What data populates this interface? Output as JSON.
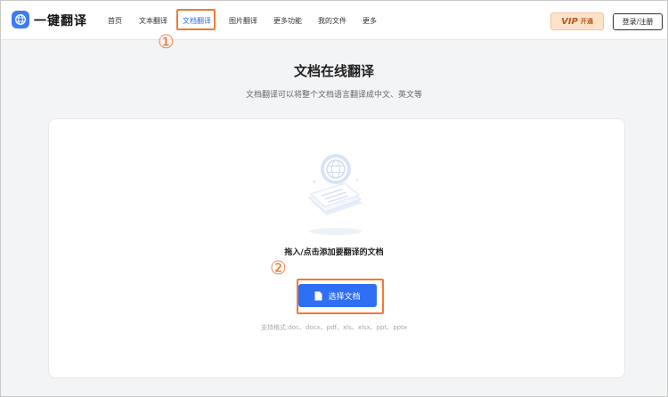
{
  "header": {
    "brand": "一键翻译",
    "nav": [
      {
        "label": "首页",
        "active": false
      },
      {
        "label": "文本翻译",
        "active": false
      },
      {
        "label": "文档翻译",
        "active": true
      },
      {
        "label": "图片翻译",
        "active": false
      },
      {
        "label": "更多功能",
        "active": false
      },
      {
        "label": "我的文件",
        "active": false
      },
      {
        "label": "更多",
        "active": false
      }
    ],
    "vip_label": "VIP",
    "vip_open": "开通",
    "login_label": "登录/注册"
  },
  "main": {
    "title": "文档在线翻译",
    "subtitle": "文档翻译可以将整个文档语言翻译成中文、英文等",
    "drop_text": "拖入/点击添加要翻译的文档",
    "choose_button": "选择文档",
    "formats": "支持格式:doc、docx、pdf、xls、xlsx、ppt、pptx"
  },
  "annotations": {
    "step1": "①",
    "step2": "②"
  },
  "colors": {
    "accent": "#2f6ff3",
    "annotation": "#f07a35",
    "vip_bg": "#fde2c9"
  },
  "icons": {
    "logo": "globe-icon",
    "button": "file-icon",
    "illustration": "document-globe-illustration"
  }
}
